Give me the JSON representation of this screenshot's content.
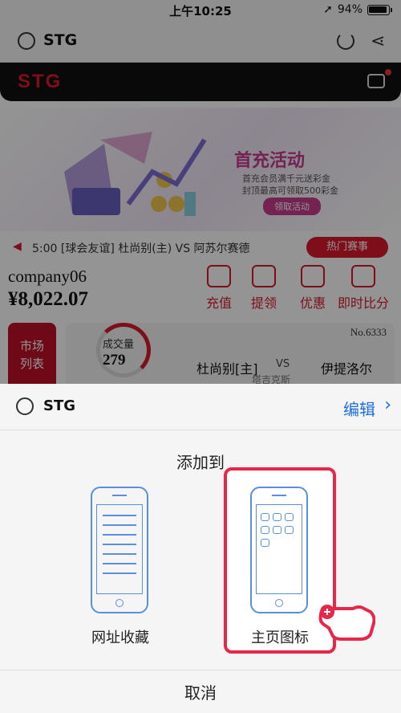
{
  "status_bar": {
    "time": "上午10:25",
    "battery": "94%"
  },
  "nav": {
    "title": "STG"
  },
  "app": {
    "logo": "STG",
    "banner": {
      "title": "首充活动",
      "sub1": "首充会员满千元送彩金",
      "sub2": "封顶最高可领取500彩金",
      "pill": "领取活动"
    },
    "ticker": {
      "text": "5:00 [球会友谊] 杜尚别(主) VS 阿苏尔赛德",
      "hot": "热门赛事"
    },
    "account": {
      "user": "company06",
      "balance": "¥8,022.07"
    },
    "quick_actions": [
      {
        "label": "充值"
      },
      {
        "label": "提领"
      },
      {
        "label": "优惠"
      },
      {
        "label": "即时比分"
      }
    ],
    "market_button": {
      "line1": "市场",
      "line2": "列表"
    },
    "match_card": {
      "volume_label": "成交量",
      "volume": "279",
      "no": "No.6333",
      "home": "杜尚别[主]",
      "vs": "VS",
      "away": "伊提洛尔",
      "venue": "塔吉克斯"
    }
  },
  "sheet": {
    "site": "STG",
    "edit": "编辑",
    "add_to": "添加到",
    "option_bookmark": "网址收藏",
    "option_home": "主页图标",
    "cancel": "取消"
  }
}
